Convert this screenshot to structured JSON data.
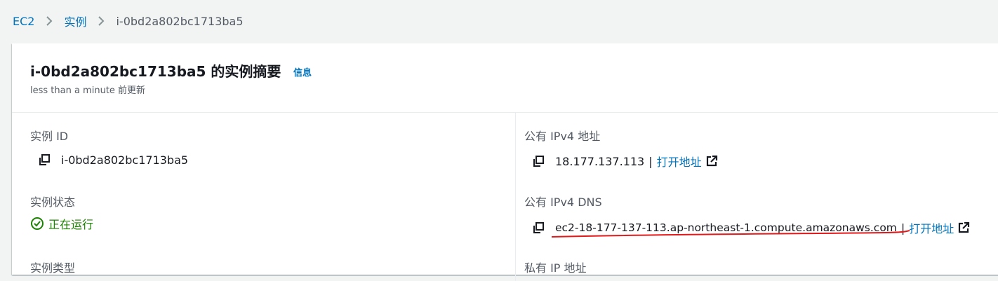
{
  "breadcrumb": {
    "items": [
      "EC2",
      "实例"
    ],
    "current": "i-0bd2a802bc1713ba5"
  },
  "summary": {
    "title": "i-0bd2a802bc1713ba5 的实例摘要",
    "info_label": "信息",
    "updated": "less than a minute 前更新"
  },
  "fields": {
    "instance_id": {
      "label": "实例 ID",
      "value": "i-0bd2a802bc1713ba5"
    },
    "public_ipv4": {
      "label": "公有 IPv4 地址",
      "value": "18.177.137.113",
      "link": "打开地址"
    },
    "instance_state": {
      "label": "实例状态",
      "value": "正在运行"
    },
    "public_dns": {
      "label": "公有 IPv4 DNS",
      "value": "ec2-18-177-137-113.ap-northeast-1.compute.amazonaws.com",
      "link": "打开地址"
    },
    "instance_type_label": "实例类型",
    "private_ip_label": "私有 IP 地址"
  },
  "icons": {
    "copy": "copy-icon",
    "external": "external-link-icon",
    "status": "check-circle-icon",
    "separator": "chevron-right-icon"
  },
  "colors": {
    "link": "#0073bb",
    "success": "#1d8102",
    "annotation": "#e0191b"
  },
  "separator_char": "|"
}
